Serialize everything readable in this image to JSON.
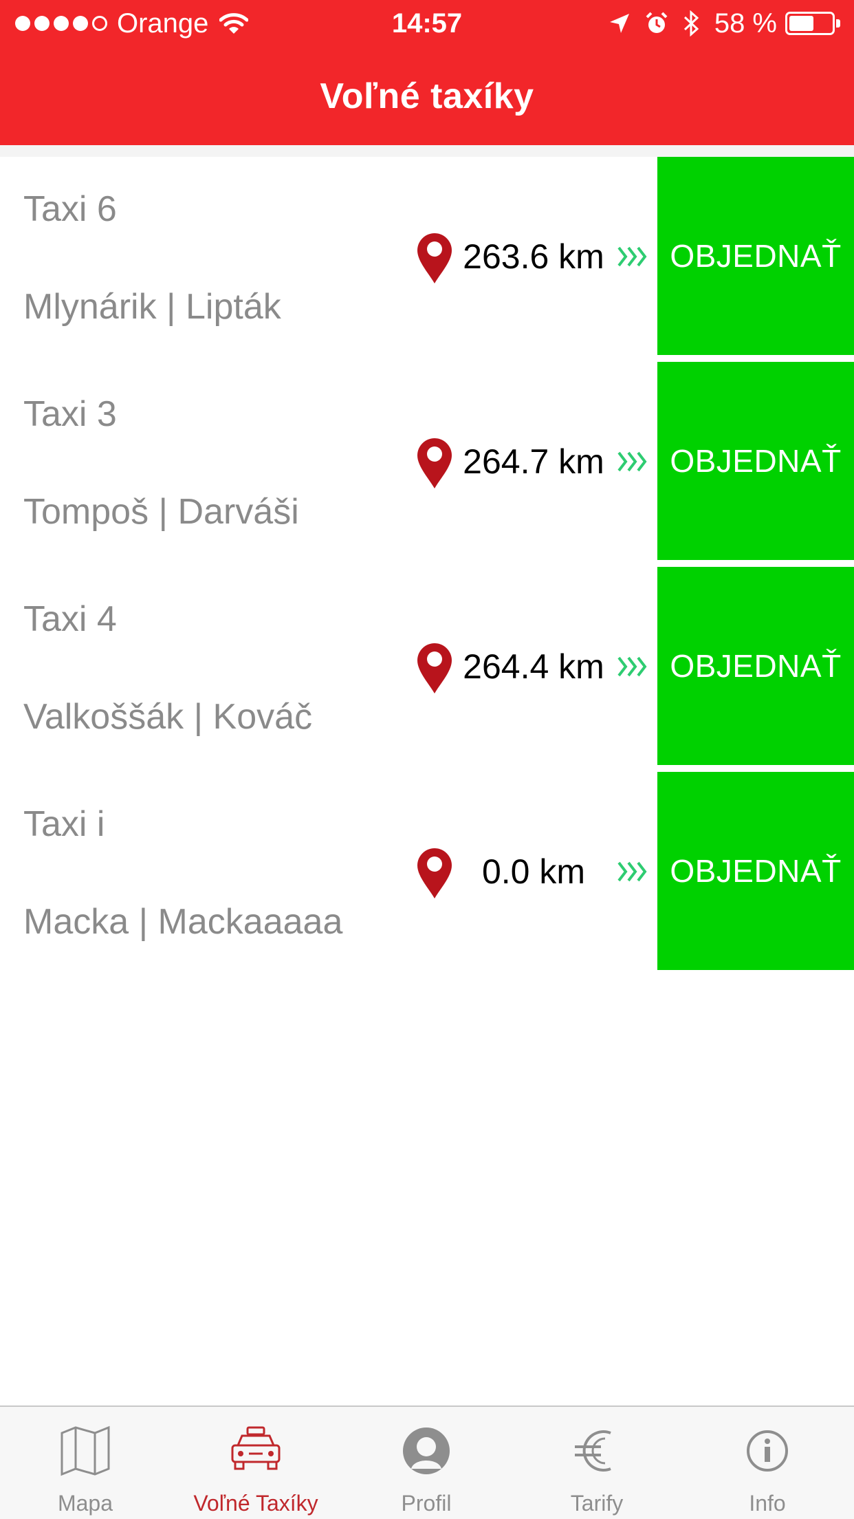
{
  "status_bar": {
    "carrier": "Orange",
    "time": "14:57",
    "battery": "58 %",
    "battery_level": 0.58,
    "signal_bars": 4,
    "signal_max": 5
  },
  "header": {
    "title": "Voľné taxíky"
  },
  "taxis": [
    {
      "name": "Taxi 6",
      "drivers": "Mlynárik | Lipták",
      "distance": "263.6 km",
      "order_label": "OBJEDNAŤ"
    },
    {
      "name": "Taxi 3",
      "drivers": "Tompoš | Darváši",
      "distance": "264.7 km",
      "order_label": "OBJEDNAŤ"
    },
    {
      "name": "Taxi 4",
      "drivers": "Valkoššák | Kováč",
      "distance": "264.4 km",
      "order_label": "OBJEDNAŤ"
    },
    {
      "name": "Taxi i",
      "drivers": "Macka | Mackaaaaa",
      "distance": "0.0 km",
      "order_label": "OBJEDNAŤ"
    }
  ],
  "tabbar": {
    "active_tab": 1,
    "tabs": [
      {
        "label": "Mapa",
        "icon": "map-icon"
      },
      {
        "label": "Voľné Taxíky",
        "icon": "taxi-icon"
      },
      {
        "label": "Profil",
        "icon": "profile-icon"
      },
      {
        "label": "Tarify",
        "icon": "euro-icon"
      },
      {
        "label": "Info",
        "icon": "info-icon"
      }
    ]
  },
  "colors": {
    "header": "#f2262a",
    "order_button": "#00d100",
    "pin": "#b8141c",
    "chevron": "#2ecc71",
    "active_tab": "#c0282c",
    "inactive_tab": "#8e8e8e"
  }
}
